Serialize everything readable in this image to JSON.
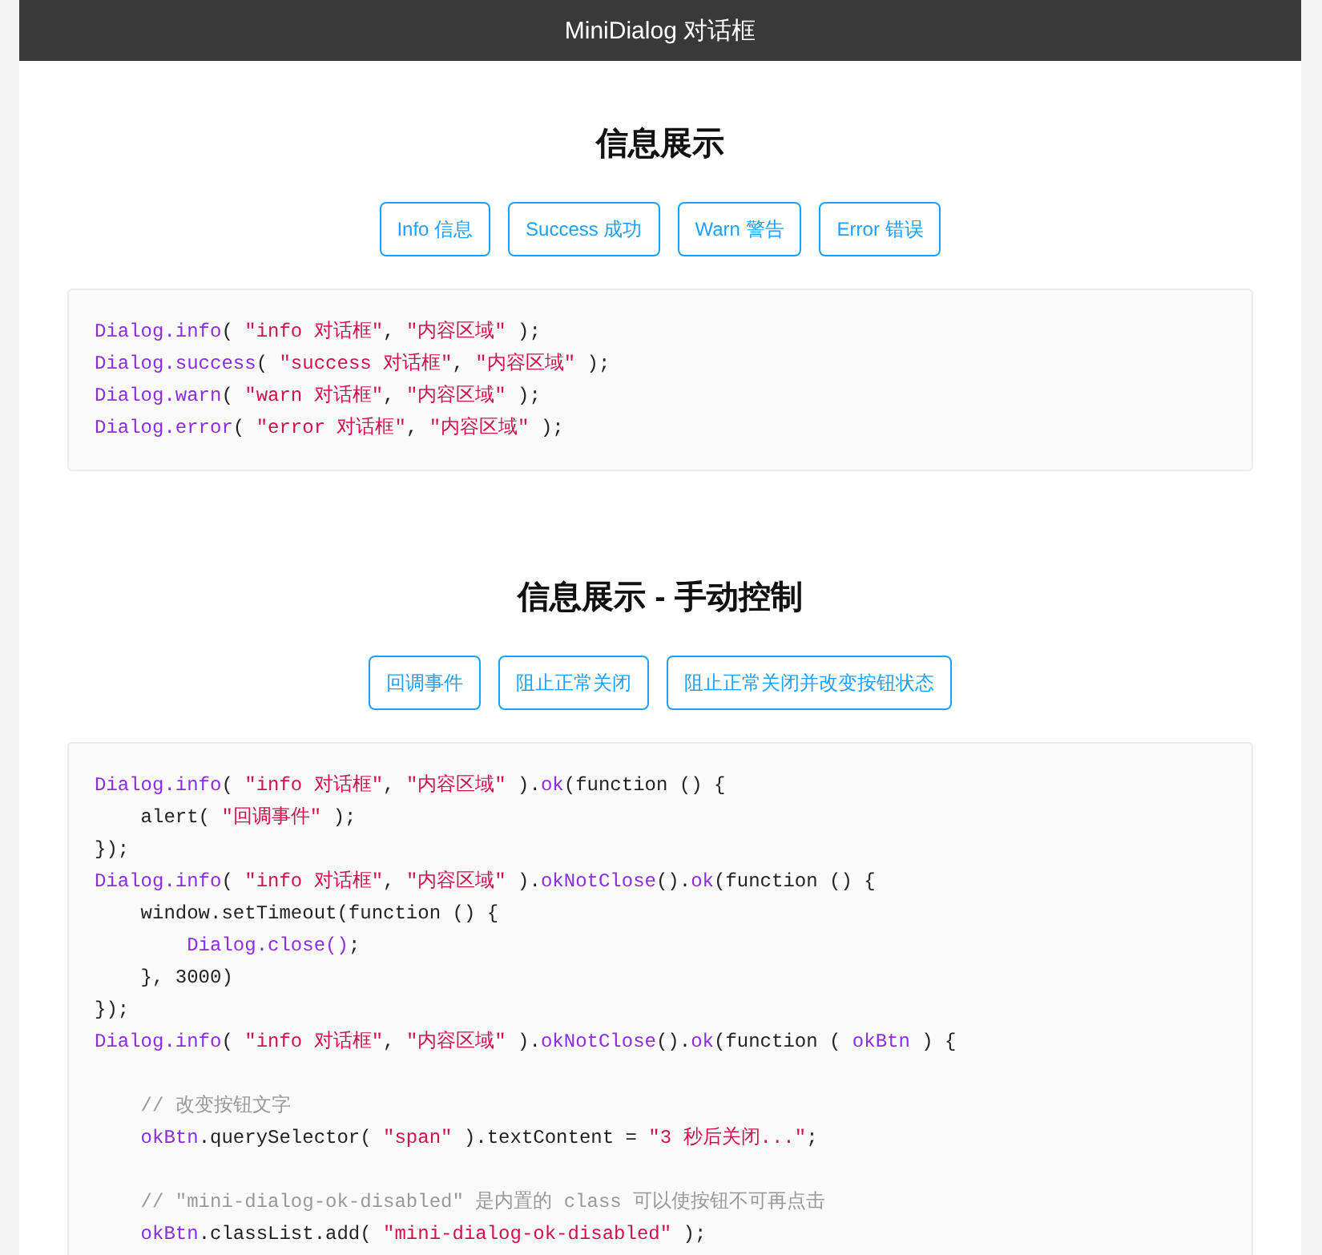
{
  "header": {
    "title": "MiniDialog 对话框"
  },
  "sections": [
    {
      "title": "信息展示",
      "buttons": [
        "Info 信息",
        "Success 成功",
        "Warn 警告",
        "Error 错误"
      ],
      "code": [
        {
          "kind": "code",
          "tokens": [
            {
              "kind": "fn",
              "text": "Dialog.info"
            },
            {
              "kind": "pl",
              "text": "( "
            },
            {
              "kind": "str",
              "text": "\"info 对话框\""
            },
            {
              "kind": "pl",
              "text": ", "
            },
            {
              "kind": "str",
              "text": "\"内容区域\""
            },
            {
              "kind": "pl",
              "text": " );"
            }
          ]
        },
        {
          "kind": "code",
          "tokens": [
            {
              "kind": "fn",
              "text": "Dialog.success"
            },
            {
              "kind": "pl",
              "text": "( "
            },
            {
              "kind": "str",
              "text": "\"success 对话框\""
            },
            {
              "kind": "pl",
              "text": ", "
            },
            {
              "kind": "str",
              "text": "\"内容区域\""
            },
            {
              "kind": "pl",
              "text": " );"
            }
          ]
        },
        {
          "kind": "code",
          "tokens": [
            {
              "kind": "fn",
              "text": "Dialog.warn"
            },
            {
              "kind": "pl",
              "text": "( "
            },
            {
              "kind": "str",
              "text": "\"warn 对话框\""
            },
            {
              "kind": "pl",
              "text": ", "
            },
            {
              "kind": "str",
              "text": "\"内容区域\""
            },
            {
              "kind": "pl",
              "text": " );"
            }
          ]
        },
        {
          "kind": "code",
          "tokens": [
            {
              "kind": "fn",
              "text": "Dialog.error"
            },
            {
              "kind": "pl",
              "text": "( "
            },
            {
              "kind": "str",
              "text": "\"error 对话框\""
            },
            {
              "kind": "pl",
              "text": ", "
            },
            {
              "kind": "str",
              "text": "\"内容区域\""
            },
            {
              "kind": "pl",
              "text": " );"
            }
          ]
        }
      ]
    },
    {
      "title": "信息展示 - 手动控制",
      "buttons": [
        "回调事件",
        "阻止正常关闭",
        "阻止正常关闭并改变按钮状态"
      ],
      "code": [
        {
          "kind": "code",
          "tokens": [
            {
              "kind": "fn",
              "text": "Dialog.info"
            },
            {
              "kind": "pl",
              "text": "( "
            },
            {
              "kind": "str",
              "text": "\"info 对话框\""
            },
            {
              "kind": "pl",
              "text": ", "
            },
            {
              "kind": "str",
              "text": "\"内容区域\""
            },
            {
              "kind": "pl",
              "text": " )."
            },
            {
              "kind": "fn",
              "text": "ok"
            },
            {
              "kind": "pl",
              "text": "(function () {"
            }
          ]
        },
        {
          "kind": "code",
          "tokens": [
            {
              "kind": "pl",
              "text": "    alert( "
            },
            {
              "kind": "str",
              "text": "\"回调事件\""
            },
            {
              "kind": "pl",
              "text": " );"
            }
          ]
        },
        {
          "kind": "code",
          "tokens": [
            {
              "kind": "pl",
              "text": "});"
            }
          ]
        },
        {
          "kind": "code",
          "tokens": [
            {
              "kind": "fn",
              "text": "Dialog.info"
            },
            {
              "kind": "pl",
              "text": "( "
            },
            {
              "kind": "str",
              "text": "\"info 对话框\""
            },
            {
              "kind": "pl",
              "text": ", "
            },
            {
              "kind": "str",
              "text": "\"内容区域\""
            },
            {
              "kind": "pl",
              "text": " )."
            },
            {
              "kind": "fn",
              "text": "okNotClose"
            },
            {
              "kind": "pl",
              "text": "()."
            },
            {
              "kind": "fn",
              "text": "ok"
            },
            {
              "kind": "pl",
              "text": "(function () {"
            }
          ]
        },
        {
          "kind": "code",
          "tokens": [
            {
              "kind": "pl",
              "text": "    window.setTimeout(function () {"
            }
          ]
        },
        {
          "kind": "code",
          "tokens": [
            {
              "kind": "fn",
              "text": "        Dialog.close()"
            },
            {
              "kind": "pl",
              "text": ";"
            }
          ]
        },
        {
          "kind": "code",
          "tokens": [
            {
              "kind": "pl",
              "text": "    }, 3000)"
            }
          ]
        },
        {
          "kind": "code",
          "tokens": [
            {
              "kind": "pl",
              "text": "});"
            }
          ]
        },
        {
          "kind": "code",
          "tokens": [
            {
              "kind": "fn",
              "text": "Dialog.info"
            },
            {
              "kind": "pl",
              "text": "( "
            },
            {
              "kind": "str",
              "text": "\"info 对话框\""
            },
            {
              "kind": "pl",
              "text": ", "
            },
            {
              "kind": "str",
              "text": "\"内容区域\""
            },
            {
              "kind": "pl",
              "text": " )."
            },
            {
              "kind": "fn",
              "text": "okNotClose"
            },
            {
              "kind": "pl",
              "text": "()."
            },
            {
              "kind": "fn",
              "text": "ok"
            },
            {
              "kind": "pl",
              "text": "(function ( "
            },
            {
              "kind": "fn",
              "text": "okBtn"
            },
            {
              "kind": "pl",
              "text": " ) {"
            }
          ]
        },
        {
          "kind": "blank"
        },
        {
          "kind": "code",
          "tokens": [
            {
              "kind": "cm",
              "text": "    // 改变按钮文字"
            }
          ]
        },
        {
          "kind": "code",
          "tokens": [
            {
              "kind": "fn",
              "text": "    okBtn"
            },
            {
              "kind": "pl",
              "text": ".querySelector( "
            },
            {
              "kind": "str",
              "text": "\"span\""
            },
            {
              "kind": "pl",
              "text": " ).textContent = "
            },
            {
              "kind": "str",
              "text": "\"3 秒后关闭...\""
            },
            {
              "kind": "pl",
              "text": ";"
            }
          ]
        },
        {
          "kind": "blank"
        },
        {
          "kind": "code",
          "tokens": [
            {
              "kind": "cm",
              "text": "    // \"mini-dialog-ok-disabled\" 是内置的 class 可以使按钮不可再点击"
            }
          ]
        },
        {
          "kind": "code",
          "tokens": [
            {
              "kind": "fn",
              "text": "    okBtn"
            },
            {
              "kind": "pl",
              "text": ".classList.add( "
            },
            {
              "kind": "str",
              "text": "\"mini-dialog-ok-disabled\""
            },
            {
              "kind": "pl",
              "text": " );"
            }
          ]
        }
      ]
    }
  ]
}
